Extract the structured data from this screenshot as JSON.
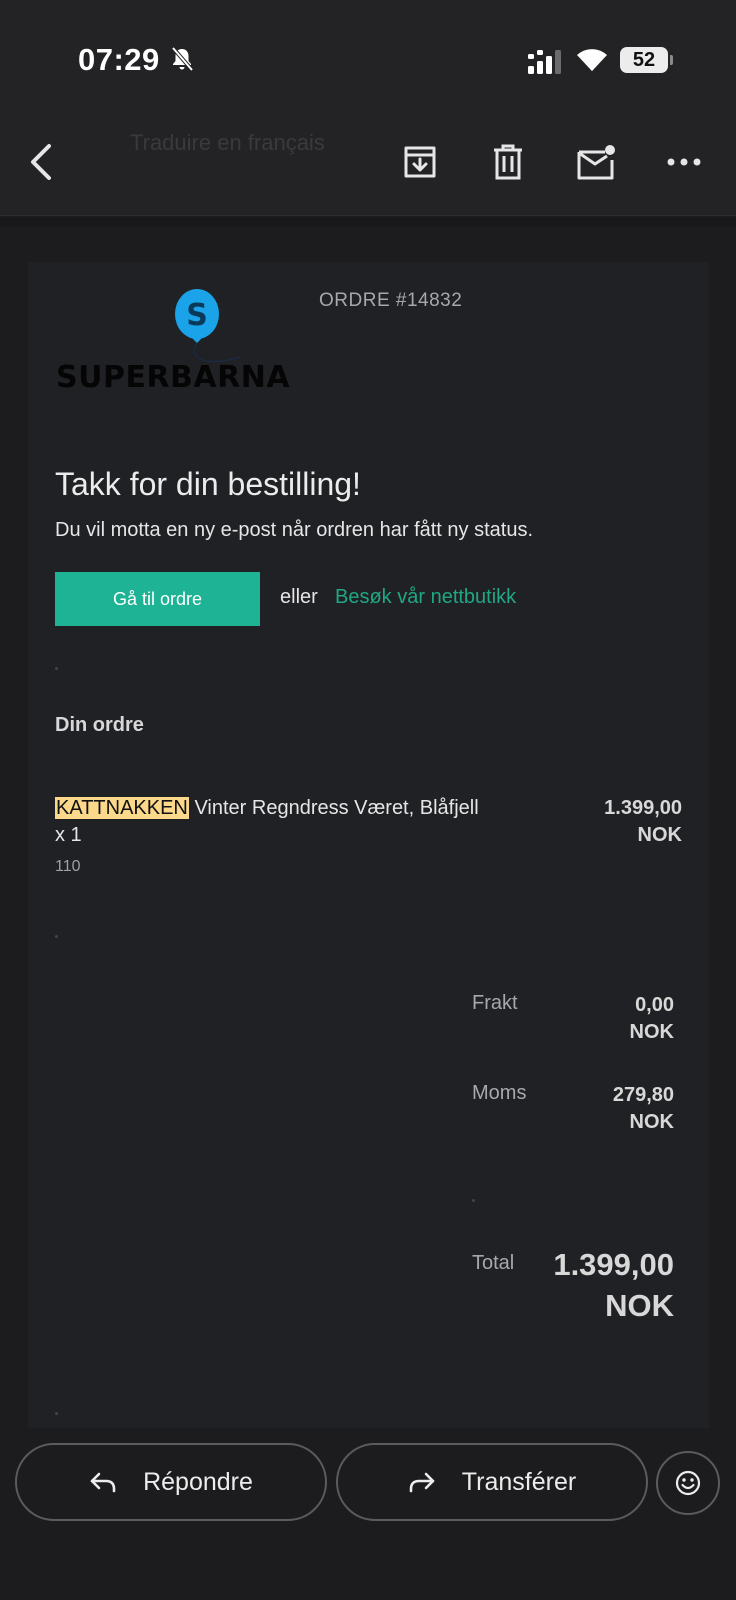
{
  "status_bar": {
    "time": "07:29",
    "battery": "52",
    "icons": [
      "bell-off-icon",
      "signal-icon",
      "wifi-icon",
      "battery-icon"
    ]
  },
  "toolbar": {
    "ghost_text": "Traduire en français",
    "icons": [
      "back-arrow-icon",
      "archive-icon",
      "trash-icon",
      "mark-unread-icon",
      "more-icon"
    ]
  },
  "email": {
    "order_number": "ORDRE #14832",
    "logo_text": "SUPERBARNA",
    "logo_mark": "S",
    "heading": "Takk for din bestilling!",
    "subtitle": "Du vil motta en ny e-post når ordren har fått ny status.",
    "cta_label": "Gå til ordre",
    "or_text": "eller",
    "shop_link": "Besøk vår nettbutikk",
    "section_title": "Din ordre",
    "item": {
      "brand": "KATTNAKKEN",
      "name": "Vinter Regndress Været, Blåfjell",
      "quantity": "x  1",
      "size": "110",
      "price_amount": "1.399,00",
      "price_currency": "NOK"
    },
    "summary": {
      "shipping_label": "Frakt",
      "shipping_amount": "0,00",
      "shipping_currency": "NOK",
      "vat_label": "Moms",
      "vat_amount": "279,80",
      "vat_currency": "NOK",
      "total_label": "Total",
      "total_amount": "1.399,00",
      "total_currency": "NOK"
    }
  },
  "actions": {
    "reply_label": "Répondre",
    "forward_label": "Transférer"
  },
  "colors": {
    "accent": "#1db394",
    "link": "#20a785",
    "highlight": "#fcd98a",
    "balloon": "#1aa3e8"
  }
}
